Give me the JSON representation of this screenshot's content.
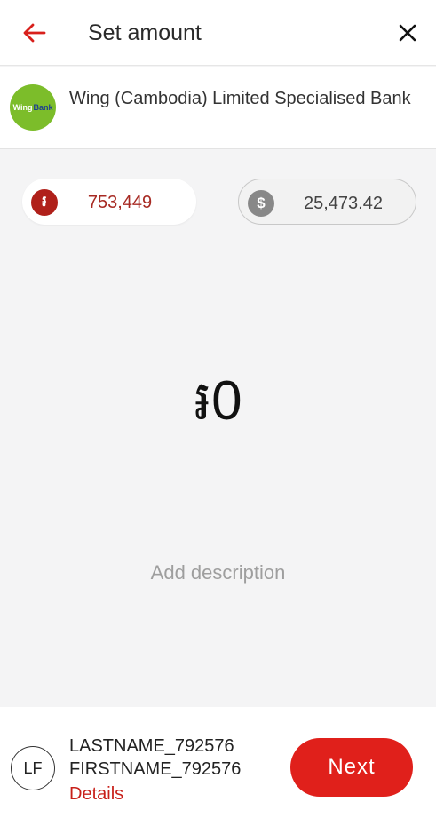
{
  "header": {
    "title": "Set amount",
    "back_icon": "arrow-left-icon",
    "close_icon": "close-icon"
  },
  "bank": {
    "name": "Wing (Cambodia) Limited Specialised Bank",
    "logo_text_wing": "Wing",
    "logo_text_bank": "Bank"
  },
  "balances": {
    "khr": {
      "symbol": "៛",
      "value": "753,449"
    },
    "usd": {
      "symbol": "$",
      "value": "25,473.42"
    }
  },
  "amount": {
    "display": "៛0"
  },
  "description": {
    "placeholder": "Add description"
  },
  "recipient": {
    "initials": "LF",
    "lastname": "LASTNAME_792576",
    "firstname": "FIRSTNAME_792576",
    "details_label": "Details"
  },
  "actions": {
    "next_label": "Next"
  },
  "colors": {
    "accent_red": "#e0201b",
    "khr_coin": "#b0201a",
    "usd_coin": "#888888",
    "bank_logo_green": "#7cbd2a"
  }
}
